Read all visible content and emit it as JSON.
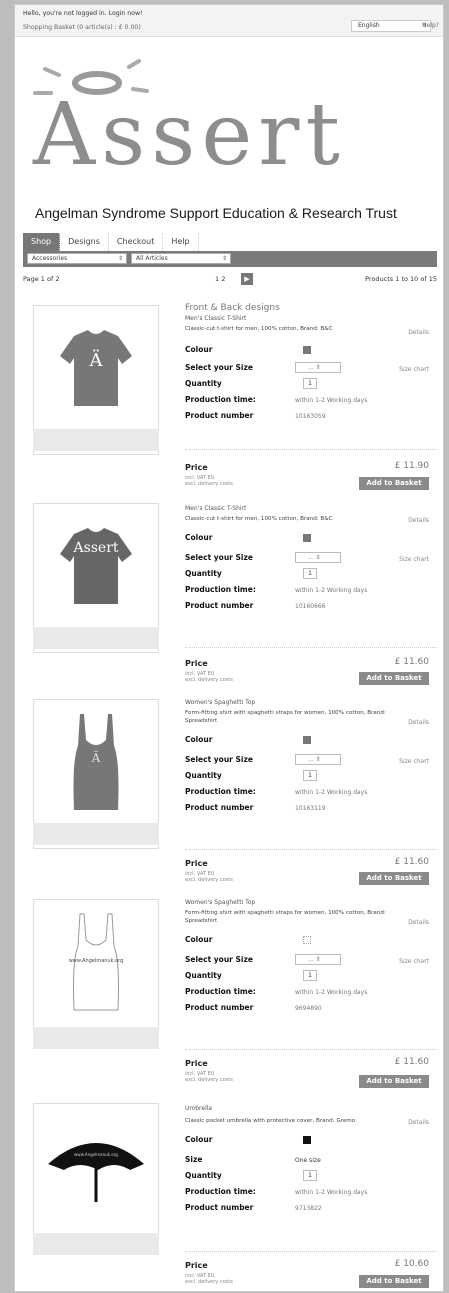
{
  "header": {
    "login_line": "Hello, you're not logged in. Login now!",
    "basket_line": "Shopping Basket (0 article(s) : £ 0.00)",
    "language": "English",
    "help": "Help?"
  },
  "logo": {
    "word": "Assert",
    "tagline": "Angelman Syndrome Support Education & Research Trust"
  },
  "nav": {
    "tabs": [
      "Shop",
      "Designs",
      "Checkout",
      "Help"
    ]
  },
  "filters": {
    "category": "Accessories",
    "articles": "All Articles"
  },
  "pager": {
    "page": "Page 1 of 2",
    "numbers": "1  2",
    "next": "▶",
    "range": "Products 1 to 10 of 15"
  },
  "labels": {
    "colour": "Colour",
    "select_size": "Select your Size",
    "size": "Size",
    "quantity": "Quantity",
    "production_time": "Production time:",
    "product_number": "Product number",
    "details": "Details",
    "size_chart": "Size chart",
    "price": "Price",
    "vat": "incl. VAT EU",
    "delivery": "excl. delivery costs",
    "add_to_basket": "Add to Basket",
    "size_placeholder": "...",
    "production_val": "within 1-2 Working days",
    "one_size": "One size",
    "qty_val": "1"
  },
  "group_title": "Front & Back designs",
  "products": [
    {
      "name": "Men's Classic T-Shirt",
      "desc": "Classic-cut t-shirt for men, 100% cotton, Brand: B&C",
      "number": "10163059",
      "price": "£ 11.90",
      "colour": "#777777"
    },
    {
      "name": "Men's Classic T-Shirt",
      "desc": "Classic-cut t-shirt for men, 100% cotton, Brand: B&C",
      "number": "10160666",
      "price": "£ 11.60",
      "colour": "#777777"
    },
    {
      "name": "Women's Spaghetti Top",
      "desc": "Form-fitting shirt with spaghetti straps for women, 100% cotton, Brand: Spreadshirt",
      "number": "10163119",
      "price": "£ 11.60",
      "colour": "#777777"
    },
    {
      "name": "Women's Spaghetti Top",
      "desc": "Form-fitting shirt with spaghetti straps for women, 100% cotton, Brand: Spreadshirt",
      "number": "9694890",
      "price": "£ 11.60",
      "colour": "#ffffff"
    },
    {
      "name": "Umbrella",
      "desc": "Classic pocket umbrella with protective cover, Brand: Gremo",
      "number": "9713822",
      "price": "£ 10.60",
      "colour": "#111111"
    }
  ],
  "image_text": {
    "tshirt2": "Assert",
    "top2": "www.Angelmanuk.org",
    "umbrella": "www.Angelmanuk.org"
  }
}
